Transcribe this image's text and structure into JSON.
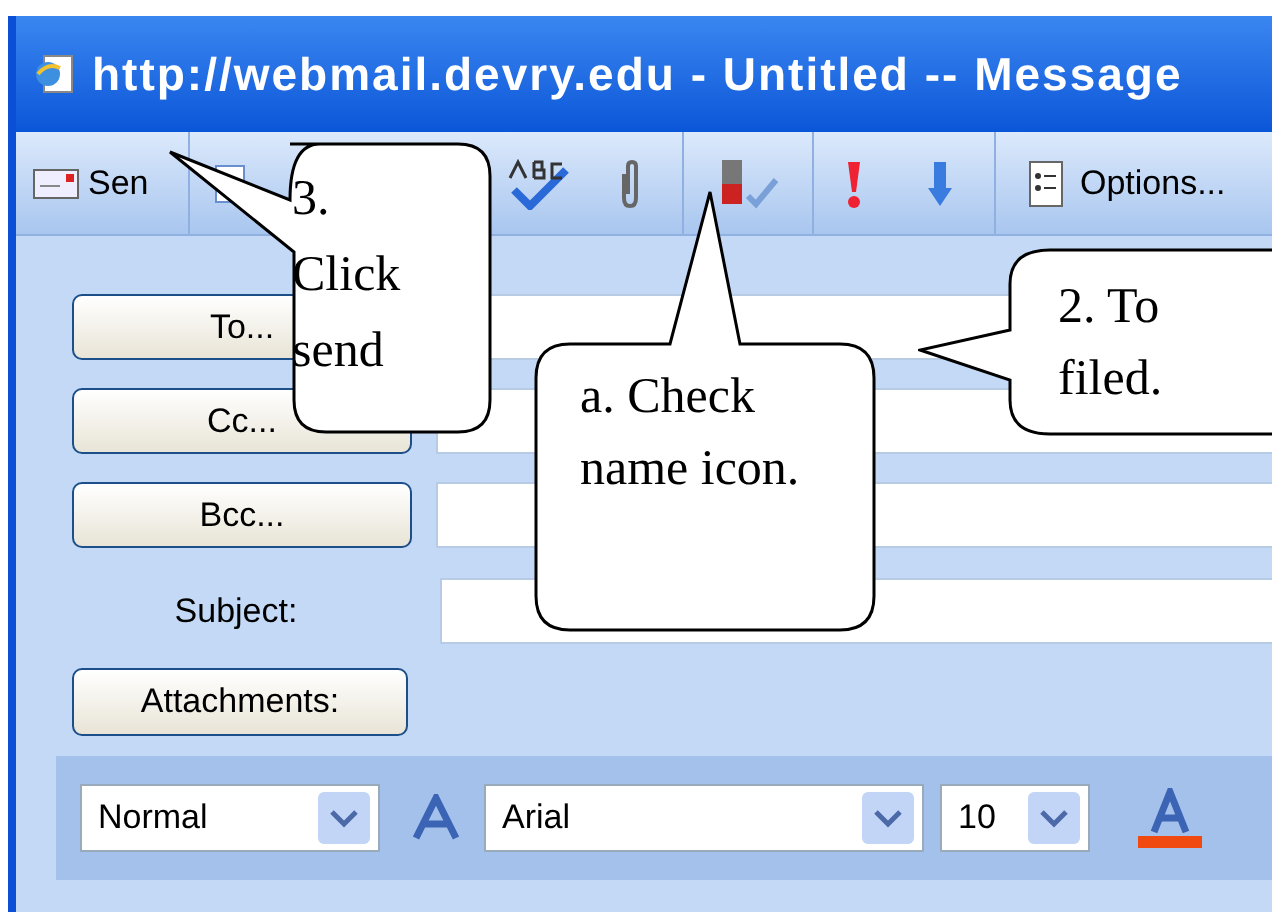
{
  "window": {
    "title": "http://webmail.devry.edu - Untitled -- Message"
  },
  "toolbar": {
    "send_label": "Sen",
    "options_label": "Options..."
  },
  "address_fields": [
    {
      "label": "To..."
    },
    {
      "label": "Cc..."
    },
    {
      "label": "Bcc..."
    }
  ],
  "subject_label": "Subject:",
  "attachments_label": "Attachments:",
  "format_bar": {
    "style": "Normal",
    "font": "Arial",
    "size": "10"
  },
  "callouts": [
    {
      "text": "3. Click send"
    },
    {
      "text": "a. Check name icon."
    },
    {
      "text": "2. To filed."
    }
  ]
}
